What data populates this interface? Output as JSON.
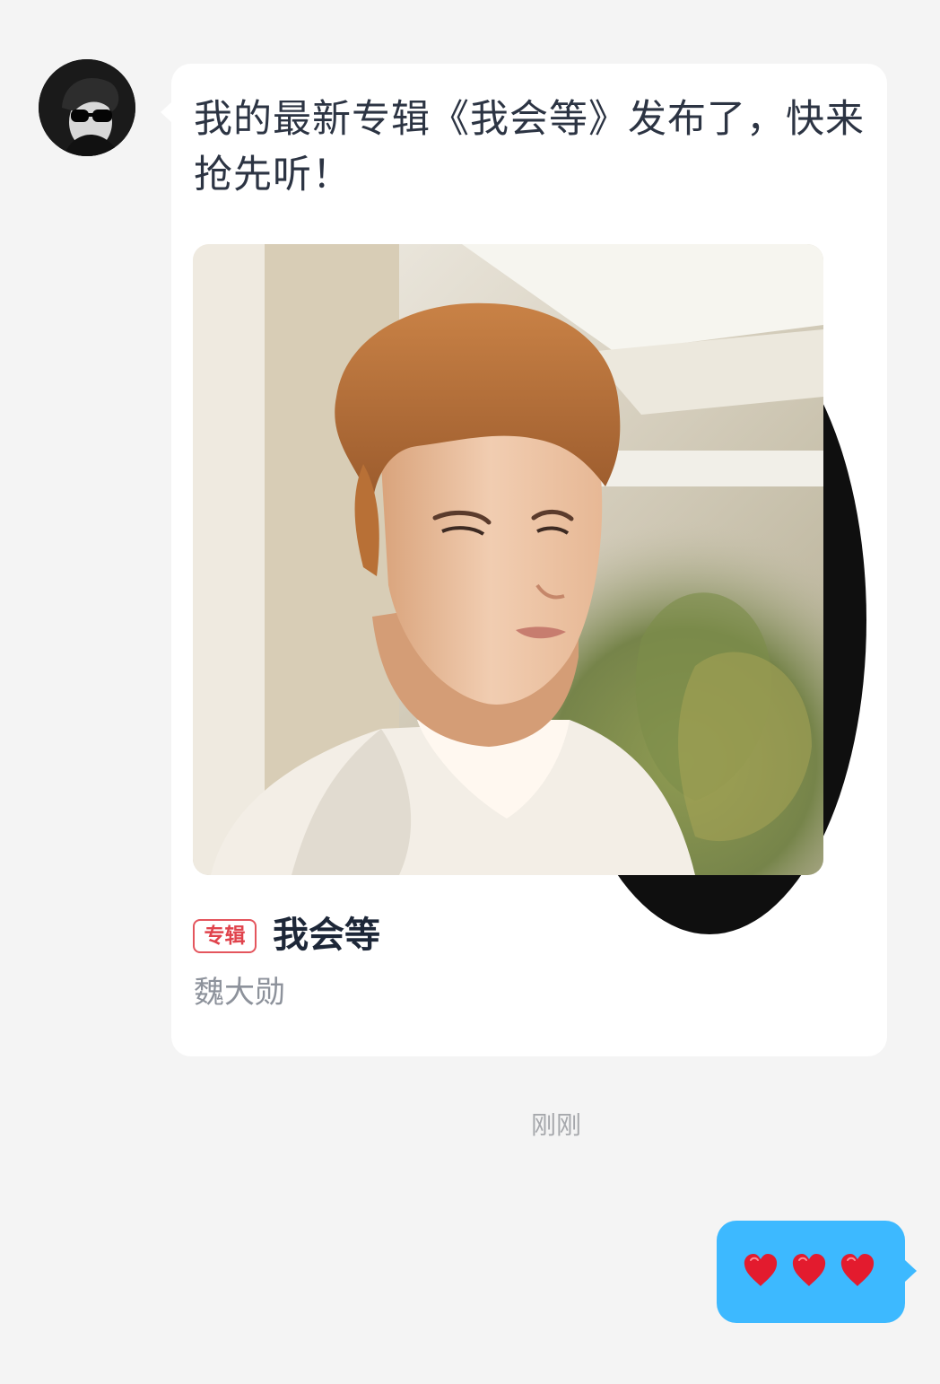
{
  "incoming_message": {
    "text": "我的最新专辑《我会等》发布了，快来抢先听！",
    "album_card": {
      "tag": "专辑",
      "title": "我会等",
      "artist": "魏大勋"
    }
  },
  "timestamp": "刚刚",
  "outgoing_message": {
    "emoji_text": "❤️❤️❤️",
    "hearts": [
      "heart-icon",
      "heart-icon",
      "heart-icon"
    ]
  },
  "colors": {
    "background": "#f4f4f4",
    "incoming_bubble": "#ffffff",
    "outgoing_bubble": "#3db9ff",
    "tag_red": "#e0434c",
    "heart_red": "#e31b2e"
  }
}
